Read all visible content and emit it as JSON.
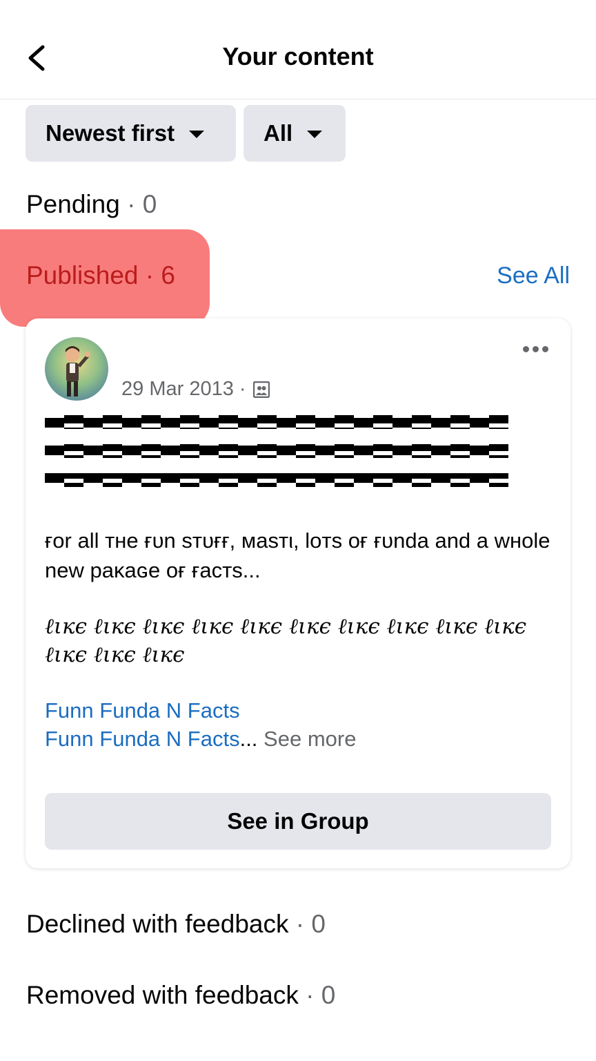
{
  "header": {
    "title": "Your content",
    "back_icon": "back-arrow-icon"
  },
  "filters": {
    "sort_label": "Newest first",
    "type_label": "All"
  },
  "sections": {
    "pending": {
      "label": "Pending",
      "count": "0"
    },
    "published": {
      "label": "Published",
      "count": "6",
      "see_all": "See All"
    },
    "declined": {
      "label": "Declined with feedback",
      "count": "0"
    },
    "removed": {
      "label": "Removed with feedback",
      "count": "0"
    }
  },
  "post": {
    "date": "29 Mar 2013",
    "body_line1": "ғor all тнe ғυn ѕтυғғ, мaѕтι, loтѕ oғ ғυnda and a wнole new paĸaɢe oғ ғacтѕ...",
    "body_line2": "ℓιкє ℓιкє ℓιкє ℓιкє ℓιкє ℓιкє ℓιкє ℓιкє ℓιкє ℓιкє ℓιкє ℓιкє ℓιкє",
    "link1": "Funn Funda N Facts",
    "link2": "Funn Funda N Facts",
    "see_more": "See more",
    "button_label": "See in Group"
  }
}
